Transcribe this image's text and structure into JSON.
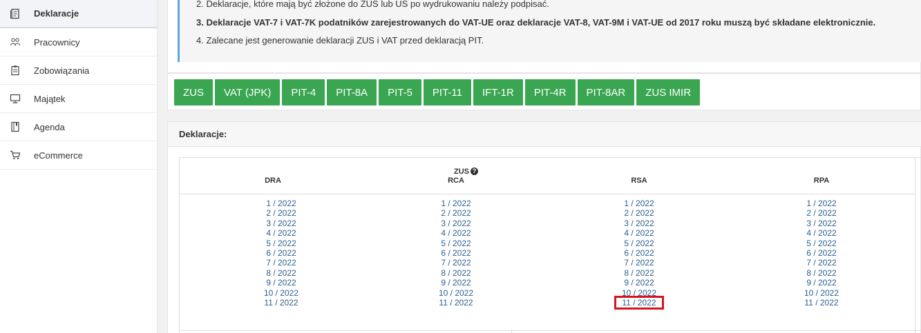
{
  "sidebar": {
    "items": [
      {
        "label": "Deklaracje",
        "icon": "document-icon"
      },
      {
        "label": "Pracownicy",
        "icon": "users-icon"
      },
      {
        "label": "Zobowiązania",
        "icon": "clipboard-icon"
      },
      {
        "label": "Majątek",
        "icon": "monitor-icon"
      },
      {
        "label": "Agenda",
        "icon": "notebook-icon"
      },
      {
        "label": "eCommerce",
        "icon": "cart-icon"
      }
    ]
  },
  "info": {
    "line2": "2. Deklaracje, które mają być złożone do ZUS lub US po wydrukowaniu należy podpisać.",
    "line3": "3. Deklaracje VAT-7 i VAT-7K podatników zarejestrowanych do VAT-UE oraz deklaracje VAT-8, VAT-9M i VAT-UE od 2017 roku muszą być składane elektronicznie.",
    "line4": "4. Zalecane jest generowanie deklaracji ZUS i VAT przed deklaracją PIT."
  },
  "buttons": [
    "ZUS",
    "VAT (JPK)",
    "PIT-4",
    "PIT-8A",
    "PIT-5",
    "PIT-11",
    "IFT-1R",
    "PIT-4R",
    "PIT-8AR",
    "ZUS IMIR"
  ],
  "declarations": {
    "title": "Deklaracje:",
    "group_header": "ZUS",
    "columns": [
      {
        "header": "DRA",
        "links": [
          "1 / 2022",
          "2 / 2022",
          "3 / 2022",
          "4 / 2022",
          "5 / 2022",
          "6 / 2022",
          "7 / 2022",
          "8 / 2022",
          "9 / 2022",
          "10 / 2022",
          "11 / 2022"
        ]
      },
      {
        "header": "RCA",
        "links": [
          "1 / 2022",
          "2 / 2022",
          "3 / 2022",
          "4 / 2022",
          "5 / 2022",
          "6 / 2022",
          "7 / 2022",
          "8 / 2022",
          "9 / 2022",
          "10 / 2022",
          "11 / 2022"
        ]
      },
      {
        "header": "RSA",
        "links": [
          "1 / 2022",
          "2 / 2022",
          "3 / 2022",
          "4 / 2022",
          "5 / 2022",
          "6 / 2022",
          "7 / 2022",
          "8 / 2022",
          "9 / 2022",
          "10 / 2022",
          "11 / 2022"
        ]
      },
      {
        "header": "RPA",
        "links": [
          "1 / 2022",
          "2 / 2022",
          "3 / 2022",
          "4 / 2022",
          "5 / 2022",
          "6 / 2022",
          "7 / 2022",
          "8 / 2022",
          "9 / 2022",
          "10 / 2022",
          "11 / 2022"
        ]
      }
    ],
    "highlighted": {
      "column": "RSA",
      "link": "11 / 2022"
    }
  },
  "colors": {
    "accent_green": "#3aa651",
    "link_blue": "#2b5d91",
    "highlight_red": "#d9131c",
    "info_border": "#5da8d8"
  }
}
